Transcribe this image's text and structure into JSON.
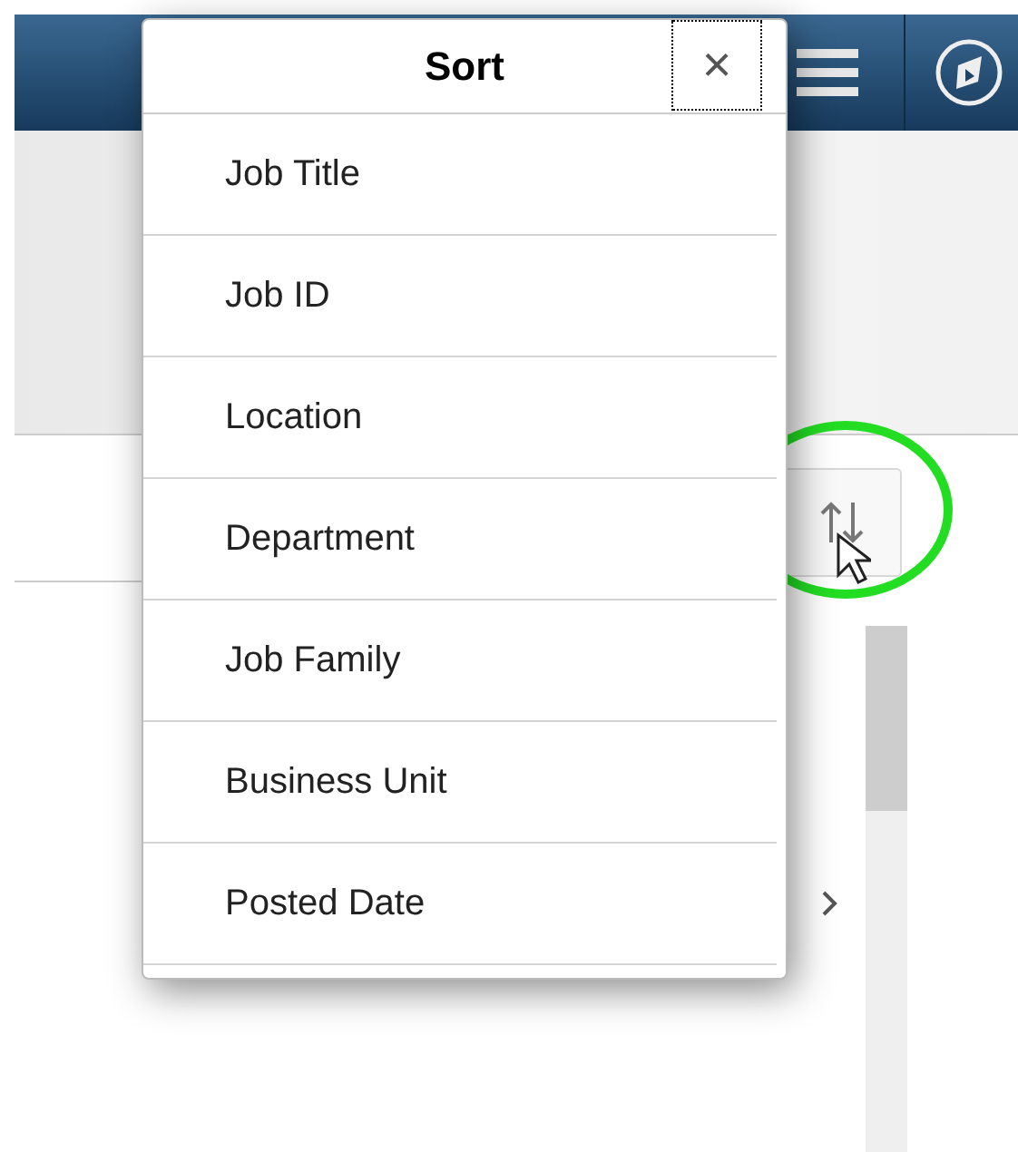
{
  "dialog": {
    "title": "Sort",
    "close_label": "×",
    "options": [
      {
        "label": "Job Title"
      },
      {
        "label": "Job ID"
      },
      {
        "label": "Location"
      },
      {
        "label": "Department"
      },
      {
        "label": "Job Family"
      },
      {
        "label": "Business Unit"
      },
      {
        "label": "Posted Date"
      }
    ]
  }
}
